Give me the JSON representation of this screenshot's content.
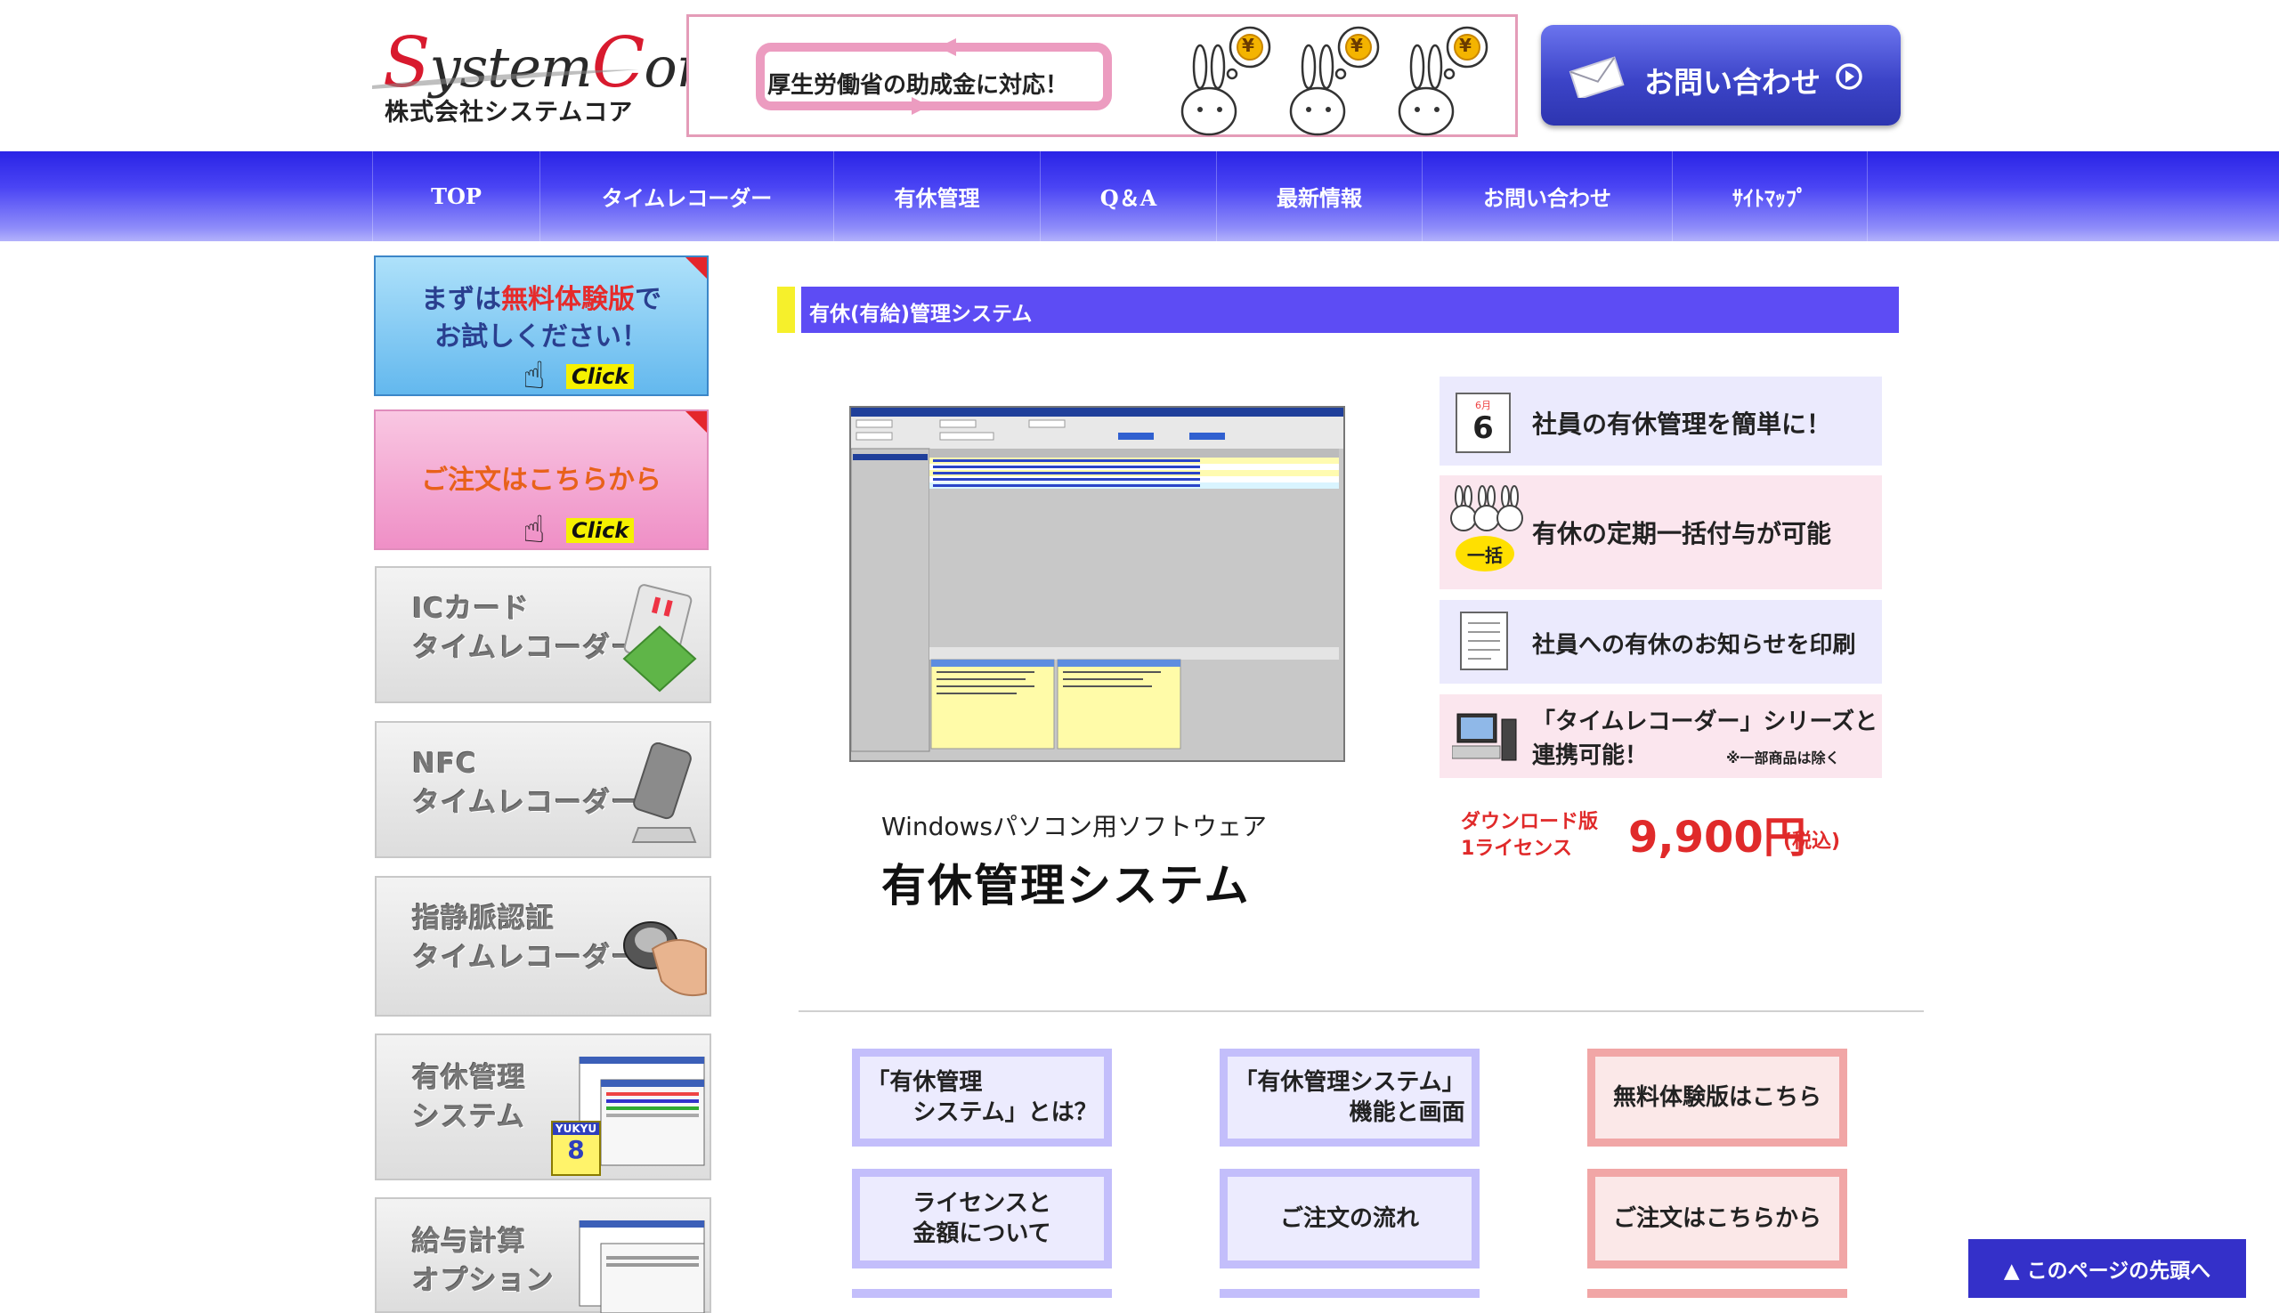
{
  "header": {
    "logo_text_s": "S",
    "logo_text_ystem": "ystem",
    "logo_text_c": "C",
    "logo_text_ore": "ore",
    "logo_sub": "株式会社システムコア",
    "banner_text": "厚生労働省の助成金に対応！",
    "banner_coin": "¥",
    "contact_label": "お問い合わせ"
  },
  "nav": {
    "items": [
      {
        "label": "TOP"
      },
      {
        "label": "タイムレコーダー"
      },
      {
        "label": "有休管理"
      },
      {
        "label": "Q＆A"
      },
      {
        "label": "最新情報"
      },
      {
        "label": "お問い合わせ"
      },
      {
        "label": "ｻｲﾄﾏｯﾌﾟ"
      }
    ]
  },
  "sidebar": {
    "trial": {
      "line1_pre": "まずは",
      "line1_em": "無料体験版",
      "line1_post": "で",
      "line2": "お試しください！",
      "click": "Click"
    },
    "order": {
      "label": "ご注文はこちらから",
      "click": "Click"
    },
    "products": [
      {
        "line1": "ICカード",
        "line2": "タイムレコーダー"
      },
      {
        "line1": "NFC",
        "line2": "タイムレコーダー"
      },
      {
        "line1": "指静脈認証",
        "line2": "タイムレコーダー"
      },
      {
        "line1": "有休管理",
        "line2": "システム",
        "badge_top": "YUKYU",
        "badge_num": "8"
      },
      {
        "line1": "給与計算",
        "line2": "オプション"
      }
    ]
  },
  "main": {
    "section_title": "有休(有給)管理システム",
    "product_sub": "Windowsパソコン用ソフトウェア",
    "product_name": "有休管理システム",
    "features": [
      {
        "text": "社員の有休管理を簡単に！",
        "icon_month": "6月",
        "icon_day": "6"
      },
      {
        "text": "有休の定期一括付与が可能",
        "icon_badge": "一括"
      },
      {
        "text": "社員への有休のお知らせを印刷"
      },
      {
        "line1": "「タイムレコーダー」シリーズと",
        "line2": "連携可能！",
        "note": "※一部商品は除く"
      }
    ],
    "price": {
      "label_line1": "ダウンロード版",
      "label_line2": "1ライセンス",
      "value": "9,900円",
      "tax": "(税込)"
    },
    "links": [
      {
        "label": "「有休管理\n　　システム」とは？"
      },
      {
        "label": "「有休管理システム」\n機能と画面"
      },
      {
        "label": "無料体験版はこちら"
      },
      {
        "label": "ライセンスと\n金額について"
      },
      {
        "label": "ご注文の流れ"
      },
      {
        "label": "ご注文はこちらから"
      }
    ]
  },
  "footer": {
    "to_top": "▲ このページの先頭へ"
  },
  "colors": {
    "nav_blue": "#3b34f0",
    "section_bar": "#5d4cf4",
    "price_red": "#e02a2a",
    "link_blue": "#c3befb",
    "link_pink": "#f1a6a6"
  }
}
